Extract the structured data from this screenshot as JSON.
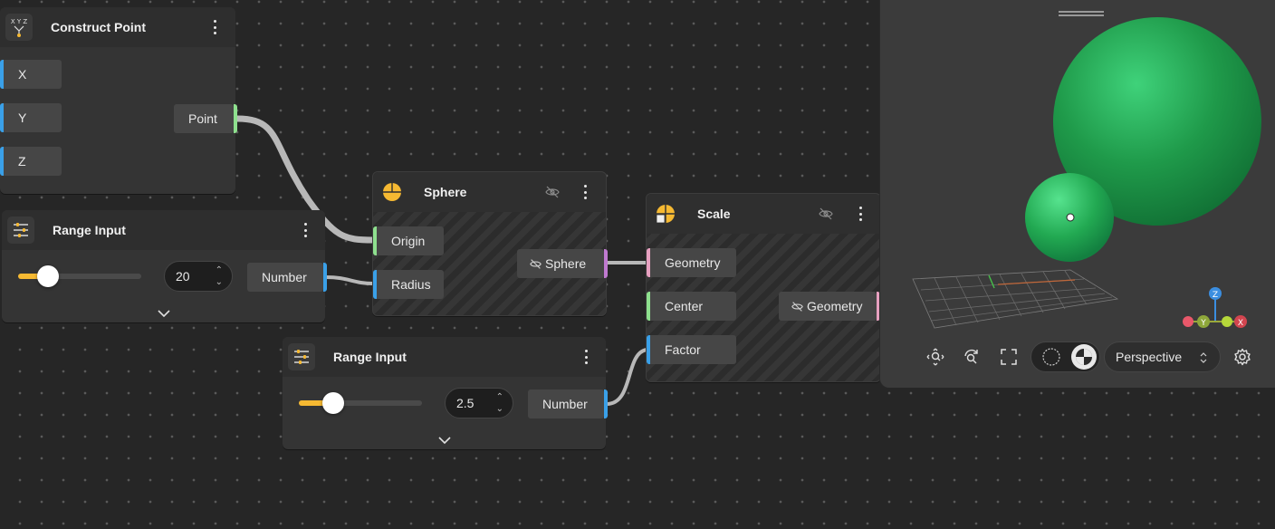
{
  "colors": {
    "accent": "#f6b932",
    "socket_number": "#3aa0e8",
    "socket_vector": "#8ee08e",
    "socket_geometry": "#e7a0c0",
    "socket_geometry_out": "#c07ad0",
    "sphere_green": "#1f9a4a"
  },
  "construct_point": {
    "title": "Construct Point",
    "icon": "xyz-icon",
    "icon_text": "X Y Z",
    "inputs": [
      "X",
      "Y",
      "Z"
    ],
    "output": "Point"
  },
  "range_input_1": {
    "title": "Range Input",
    "icon": "sliders-icon",
    "value": "20",
    "slider_level": 0.2,
    "output": "Number"
  },
  "range_input_2": {
    "title": "Range Input",
    "icon": "sliders-icon",
    "value": "2.5",
    "slider_level": 0.2,
    "output": "Number"
  },
  "sphere": {
    "title": "Sphere",
    "icon": "sphere-icon",
    "inputs": [
      "Origin",
      "Radius"
    ],
    "output": "Sphere"
  },
  "scale": {
    "title": "Scale",
    "icon": "scale-icon",
    "inputs": [
      "Geometry",
      "Center",
      "Factor"
    ],
    "output": "Geometry"
  },
  "viewport": {
    "camera_mode": "Perspective",
    "axes": {
      "z": "Z",
      "y": "Y",
      "x": "X"
    }
  }
}
